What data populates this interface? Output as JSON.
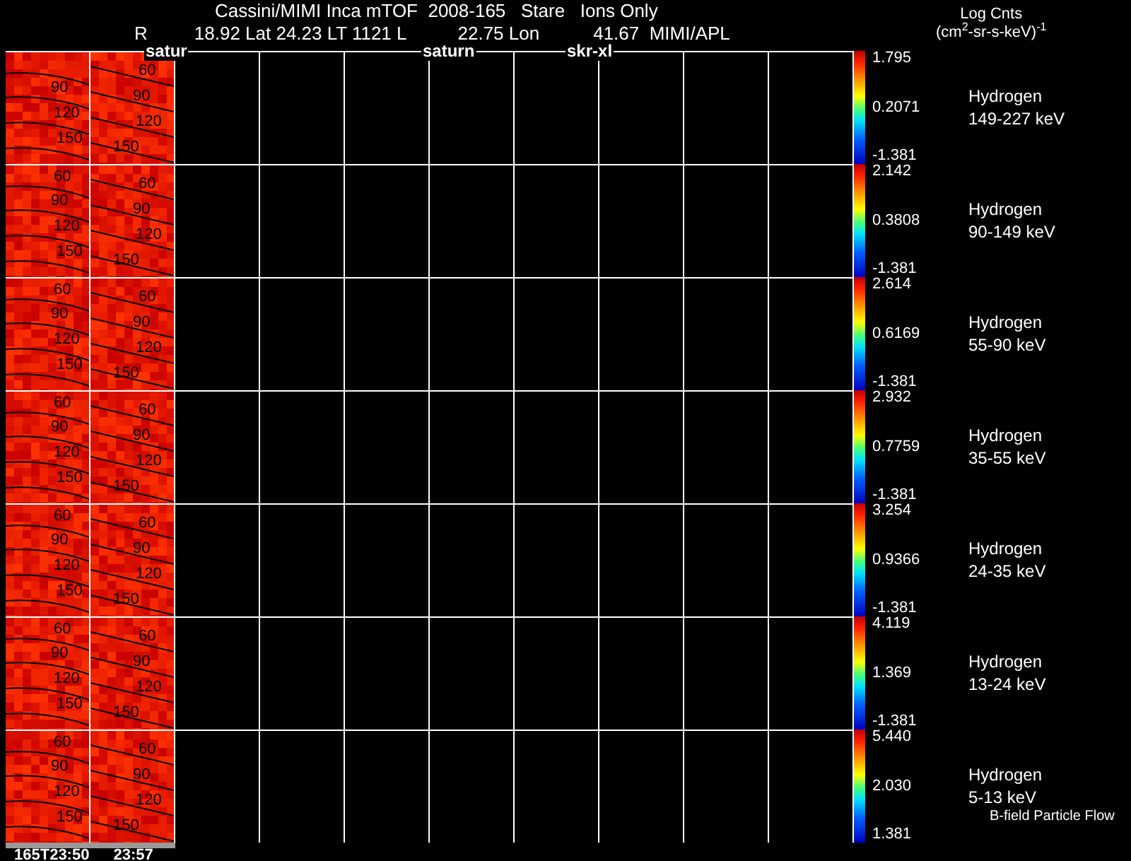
{
  "header": {
    "title": "Cassini/MIMI Inca mTOF  2008-165   Stare   Ions Only",
    "info": [
      "R",
      "18.92 Lat 24.23 LT 1121 L",
      "22.75 Lon",
      "41.67  MIMI/APL"
    ]
  },
  "units": {
    "title": "Log Cnts",
    "label": "(cm$^{2}$-sr-s-keV)$^{-1}$"
  },
  "overlay_labels": [
    "satur",
    "saturn",
    "skr-xl"
  ],
  "panels": [
    {
      "max": "1.795",
      "mid": "0.2071",
      "min": "-1.381",
      "species": "Hydrogen",
      "energy": "149-227 keV",
      "left_contours": [
        "90",
        "120",
        "150"
      ],
      "right_contours": [
        "60",
        "90",
        "120",
        "150"
      ]
    },
    {
      "max": "2.142",
      "mid": "0.3808",
      "min": "-1.381",
      "species": "Hydrogen",
      "energy": "90-149 keV",
      "left_contours": [
        "60",
        "90",
        "120",
        "150"
      ],
      "right_contours": [
        "60",
        "90",
        "120",
        "150"
      ]
    },
    {
      "max": "2.614",
      "mid": "0.6169",
      "min": "-1.381",
      "species": "Hydrogen",
      "energy": "55-90 keV",
      "left_contours": [
        "60",
        "90",
        "120",
        "150"
      ],
      "right_contours": [
        "60",
        "90",
        "120",
        "150"
      ]
    },
    {
      "max": "2.932",
      "mid": "0.7759",
      "min": "-1.381",
      "species": "Hydrogen",
      "energy": "35-55 keV",
      "left_contours": [
        "60",
        "90",
        "120",
        "150"
      ],
      "right_contours": [
        "60",
        "90",
        "120",
        "150"
      ]
    },
    {
      "max": "3.254",
      "mid": "0.9366",
      "min": "-1.381",
      "species": "Hydrogen",
      "energy": "24-35 keV",
      "left_contours": [
        "60",
        "90",
        "120",
        "150"
      ],
      "right_contours": [
        "60",
        "90",
        "120",
        "150"
      ]
    },
    {
      "max": "4.119",
      "mid": "1.369",
      "min": "-1.381",
      "species": "Hydrogen",
      "energy": "13-24 keV",
      "left_contours": [
        "60",
        "90",
        "120",
        "150"
      ],
      "right_contours": [
        "60",
        "90",
        "120",
        "150"
      ]
    },
    {
      "max": "5.440",
      "mid": "2.030",
      "min": "1.381",
      "species": "Hydrogen",
      "energy": "5-13 keV",
      "left_contours": [
        "60",
        "90",
        "120",
        "150"
      ],
      "right_contours": [
        "60",
        "90",
        "120",
        "150"
      ]
    }
  ],
  "footer_note": "B-field Particle Flow",
  "time_labels": [
    "165T23:50",
    "23:57"
  ]
}
